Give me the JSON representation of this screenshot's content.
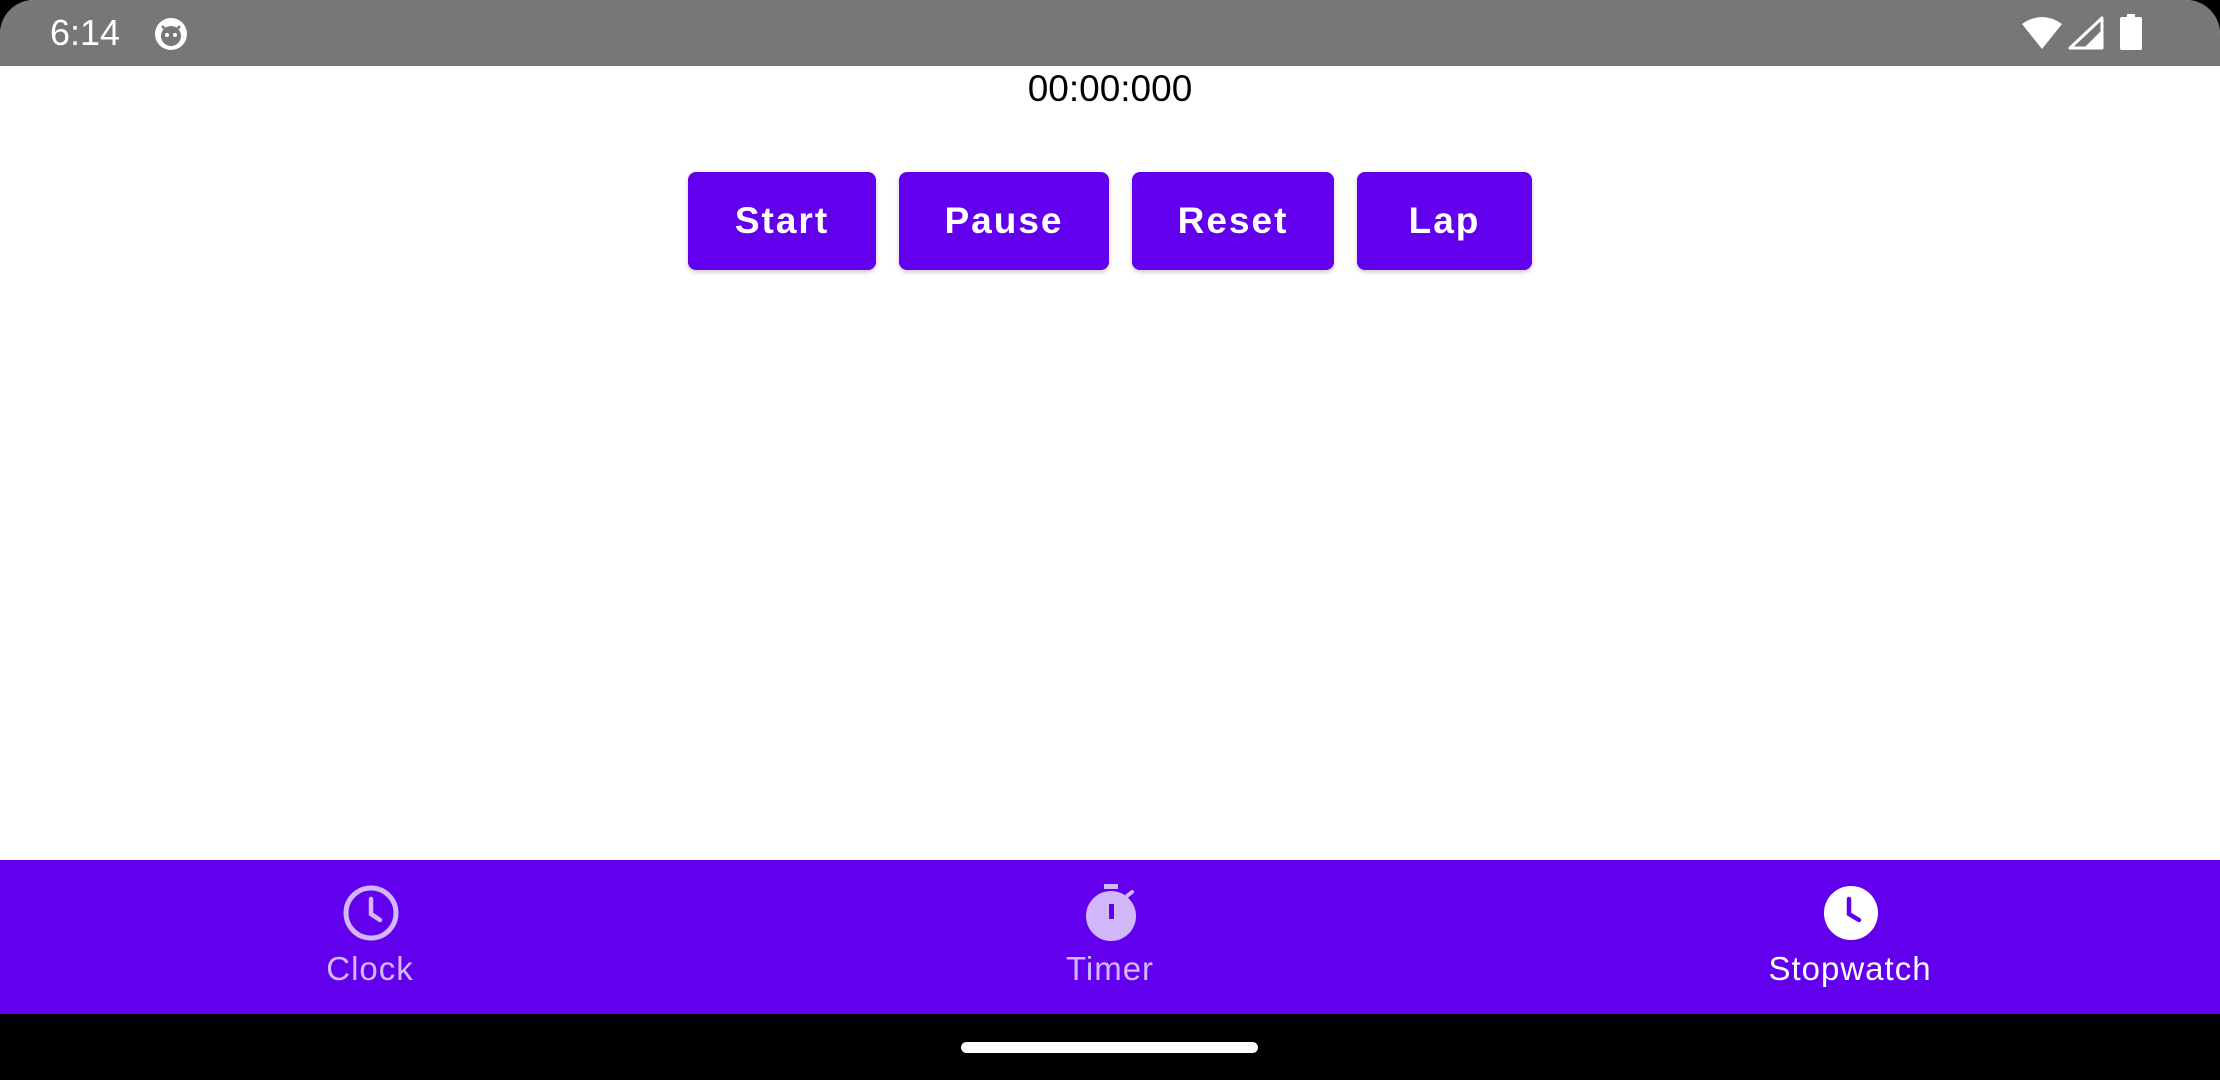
{
  "status_bar": {
    "time": "6:14",
    "icons": [
      "debug-icon",
      "wifi-icon",
      "cell-signal-icon",
      "battery-icon"
    ]
  },
  "stopwatch": {
    "elapsed": "00:00:000"
  },
  "buttons": {
    "start": "Start",
    "pause": "Pause",
    "reset": "Reset",
    "lap": "Lap"
  },
  "bottom_nav": {
    "items": [
      {
        "label": "Clock",
        "icon": "clock-icon",
        "selected": false
      },
      {
        "label": "Timer",
        "icon": "timer-icon",
        "selected": false
      },
      {
        "label": "Stopwatch",
        "icon": "stopwatch-icon",
        "selected": true
      }
    ]
  },
  "colors": {
    "primary": "#6200ee",
    "status_bar": "#777777",
    "nav_inactive": "#d3b7fb",
    "nav_active": "#ffffff"
  }
}
